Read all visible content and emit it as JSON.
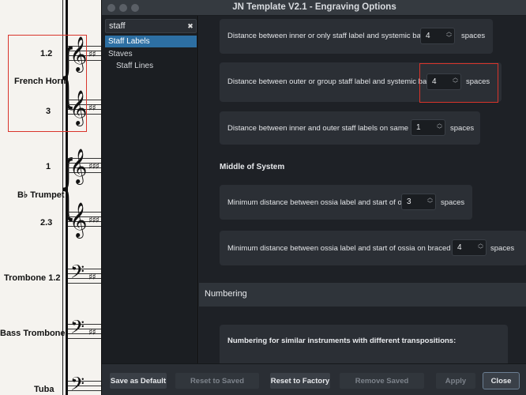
{
  "score": {
    "instruments": [
      {
        "name": "French Horn",
        "parts": [
          "1.2",
          "3"
        ]
      },
      {
        "name": "B♭ Trumpet",
        "parts": [
          "1",
          "2.3"
        ]
      },
      {
        "name": "Trombone 1.2"
      },
      {
        "name": "Bass Trombone"
      },
      {
        "name": "Tuba"
      }
    ]
  },
  "window": {
    "title": "JN Template V2.1 - Engraving Options"
  },
  "sidebar": {
    "search_value": "staff",
    "clear_glyph": "✖",
    "items": [
      {
        "label": "Staff Labels",
        "active": true
      },
      {
        "label": "Staves"
      },
      {
        "label": "Staff Lines"
      }
    ]
  },
  "content": {
    "options": [
      {
        "label": "Distance between inner or only staff label and systemic barline:",
        "value": "4",
        "units": "spaces"
      },
      {
        "label": "Distance between outer or group staff label and systemic barline:",
        "value": "4",
        "units": "spaces"
      },
      {
        "label": "Distance between inner and outer staff labels on same staff:",
        "value": "1",
        "units": "spaces"
      }
    ],
    "middle_heading": "Middle of System",
    "ossia_options": [
      {
        "label": "Minimum distance between ossia label and start of ossia:",
        "value": "3",
        "units": "spaces"
      },
      {
        "label": "Minimum distance between ossia label and start of ossia on braced staves:",
        "value": "4",
        "units": "spaces"
      }
    ],
    "numbering_section": "Numbering",
    "numbering_heading": "Numbering for similar instruments with different transpositions:"
  },
  "footer": {
    "save_default": "Save as Default",
    "reset_saved": "Reset to Saved Defaults",
    "reset_factory": "Reset to Factory",
    "remove_saved": "Remove Saved Defaults",
    "apply": "Apply",
    "close": "Close"
  },
  "colors": {
    "accent": "#2d6fa3",
    "highlight": "#d9342b",
    "panel": "#23272d"
  }
}
